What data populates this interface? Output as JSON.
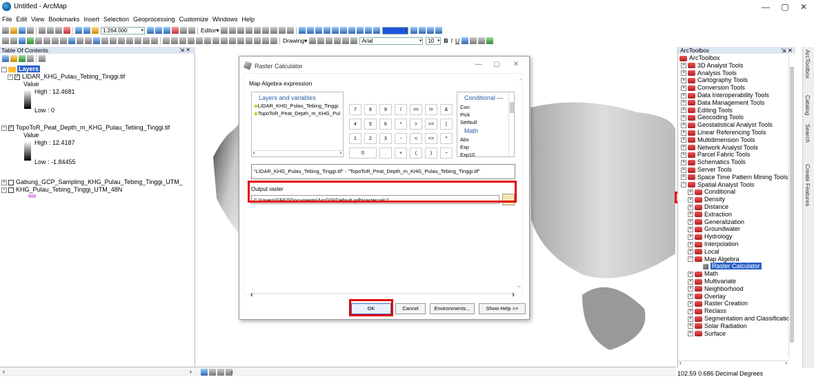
{
  "window": {
    "title": "Untitled - ArcMap"
  },
  "menu": [
    "File",
    "Edit",
    "View",
    "Bookmarks",
    "Insert",
    "Selection",
    "Geoprocessing",
    "Customize",
    "Windows",
    "Help"
  ],
  "toolbar": {
    "scale": "1:264.000",
    "editor": "Editor▾",
    "drawing": "Drawing▾",
    "font": "Arial",
    "font_size": "10"
  },
  "toc": {
    "title": "Table Of Contents",
    "root": "Layers",
    "layer1": {
      "name": "LIDAR_KHG_Pulau_Tebing_Tinggi.tif",
      "value_label": "Value",
      "high": "High : 12.4681",
      "low": "Low : 0"
    },
    "layer2": {
      "name": "TopoToR_Peat_Depth_m_KHG_Pulau_Tebing_Tinggi.tif",
      "value_label": "Value",
      "high": "High : 12.4187",
      "low": "Low : -1.84455"
    },
    "layer3": {
      "name": "Gabung_GCP_Sampling_KHG_Pulau_Tebing_Tinggi_UTM_"
    },
    "layer4": {
      "name": "KHG_Pulau_Tebing_Tinggi_UTM_48N"
    }
  },
  "dialog": {
    "title": "Raster Calculator",
    "section": "Map Algebra expression",
    "layers_header": "Layers and variables",
    "layers": [
      "LIDAR_KHG_Pulau_Tebing_Tinggi.",
      "TopoToR_Peat_Depth_m_KHG_Pul"
    ],
    "keys_row1": [
      "7",
      "8",
      "9",
      "/",
      "==",
      "!=",
      "&"
    ],
    "keys_row2": [
      "4",
      "5",
      "6",
      "*",
      ">",
      ">=",
      "|"
    ],
    "keys_row3": [
      "1",
      "2",
      "3",
      "-",
      "<",
      "<=",
      "^"
    ],
    "keys_row4": [
      "0",
      ".",
      "+",
      "(",
      ")",
      "~"
    ],
    "cond_header": "Conditional —",
    "cond_items": [
      "Con",
      "Pick",
      "SetNull"
    ],
    "math_header": "Math",
    "math_items": [
      "Abs",
      "Exp",
      "Exp10"
    ],
    "expression": "\"LIDAR_KHG_Pulau_Tebing_Tinggi.tif\" - \"TopoToR_Peat_Depth_m_KHG_Pulau_Tebing_Tinggi.tif\"",
    "output_label": "Output raster",
    "output_path": "C:\\Users\\GE62\\Documents\\ArcGIS\\Default.gdb\\rastercalc2",
    "ok": "OK",
    "cancel": "Cancel",
    "env": "Environments...",
    "help": "Show Help >>"
  },
  "toolbox": {
    "title": "ArcToolbox",
    "root": "ArcToolbox",
    "tools": [
      "3D Analyst Tools",
      "Analysis Tools",
      "Cartography Tools",
      "Conversion Tools",
      "Data Interoperability Tools",
      "Data Management Tools",
      "Editing Tools",
      "Geocoding Tools",
      "Geostatistical Analyst Tools",
      "Linear Referencing Tools",
      "Multidimension Tools",
      "Network Analyst Tools",
      "Parcel Fabric Tools",
      "Schematics Tools",
      "Server Tools",
      "Space Time Pattern Mining Tools",
      "Spatial Analyst Tools"
    ],
    "spatial": [
      "Conditional",
      "Density",
      "Distance",
      "Extraction",
      "Generalization",
      "Groundwater",
      "Hydrology",
      "Interpolation",
      "Local",
      "Map Algebra"
    ],
    "raster_calc": "Raster Calculator",
    "spatial2": [
      "Math",
      "Multivariate",
      "Neighborhood",
      "Overlay",
      "Raster Creation",
      "Reclass",
      "Segmentation and Classification",
      "Solar Radiation",
      "Surface"
    ]
  },
  "side_tabs": [
    "ArcToolbox",
    "Catalog",
    "Search",
    "Create Features"
  ],
  "status": "102.59  0.686 Decimal Degrees"
}
